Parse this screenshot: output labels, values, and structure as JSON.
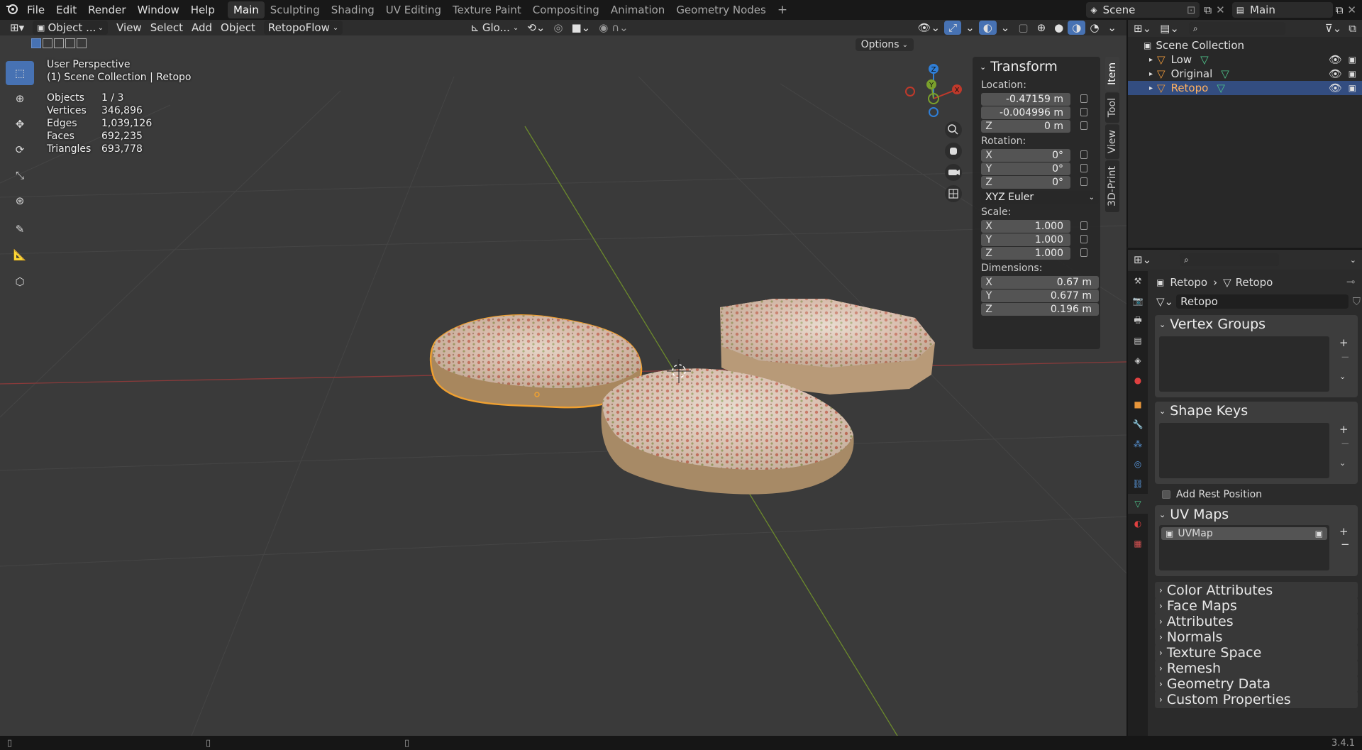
{
  "menu": [
    "File",
    "Edit",
    "Render",
    "Window",
    "Help"
  ],
  "workspaces": [
    "Main",
    "Sculpting",
    "Shading",
    "UV Editing",
    "Texture Paint",
    "Compositing",
    "Animation",
    "Geometry Nodes"
  ],
  "active_workspace": "Main",
  "scene_name": "Scene",
  "view_layer": "Main",
  "viewport_header": {
    "mode": "Object ...",
    "items": [
      "View",
      "Select",
      "Add",
      "Object"
    ],
    "addon": "RetopoFlow",
    "orientation": "Glo...",
    "options": "Options"
  },
  "overlay": {
    "perspective": "User Perspective",
    "collection": "(1) Scene Collection | Retopo"
  },
  "stats": [
    {
      "k": "Objects",
      "v": "1 / 3"
    },
    {
      "k": "Vertices",
      "v": "346,896"
    },
    {
      "k": "Edges",
      "v": "1,039,126"
    },
    {
      "k": "Faces",
      "v": "692,235"
    },
    {
      "k": "Triangles",
      "v": "693,778"
    }
  ],
  "transform": {
    "title": "Transform",
    "location_label": "Location:",
    "location": [
      "-0.47159 m",
      "-0.004996 m",
      "0 m"
    ],
    "rotation_label": "Rotation:",
    "rotation": [
      "0°",
      "0°",
      "0°"
    ],
    "rotation_mode": "XYZ Euler",
    "scale_label": "Scale:",
    "scale": [
      "1.000",
      "1.000",
      "1.000"
    ],
    "dimensions_label": "Dimensions:",
    "dimensions": [
      "0.67 m",
      "0.677 m",
      "0.196 m"
    ],
    "axis_z": "Z",
    "axes": [
      "X",
      "Y",
      "Z"
    ]
  },
  "sidebar_tabs": [
    "Item",
    "Tool",
    "View",
    "3D-Print"
  ],
  "outliner": {
    "root": "Scene Collection",
    "items": [
      "Low",
      "Original",
      "Retopo"
    ],
    "selected": "Retopo"
  },
  "properties": {
    "breadcrumb_obj": "Retopo",
    "breadcrumb_data": "Retopo",
    "mesh_name": "Retopo",
    "vertex_groups": "Vertex Groups",
    "shape_keys": "Shape Keys",
    "add_rest_position": "Add Rest Position",
    "uv_maps": "UV Maps",
    "uv_map_item": "UVMap",
    "collapsed": [
      "Color Attributes",
      "Face Maps",
      "Attributes",
      "Normals",
      "Texture Space",
      "Remesh",
      "Geometry Data",
      "Custom Properties"
    ]
  },
  "version": "3.4.1",
  "colors": {
    "accent": "#4772b3",
    "selection_outline": "#f0a030",
    "x_axis": "#c0392b",
    "y_axis": "#7aa02c",
    "z_axis": "#2f7fd8"
  }
}
